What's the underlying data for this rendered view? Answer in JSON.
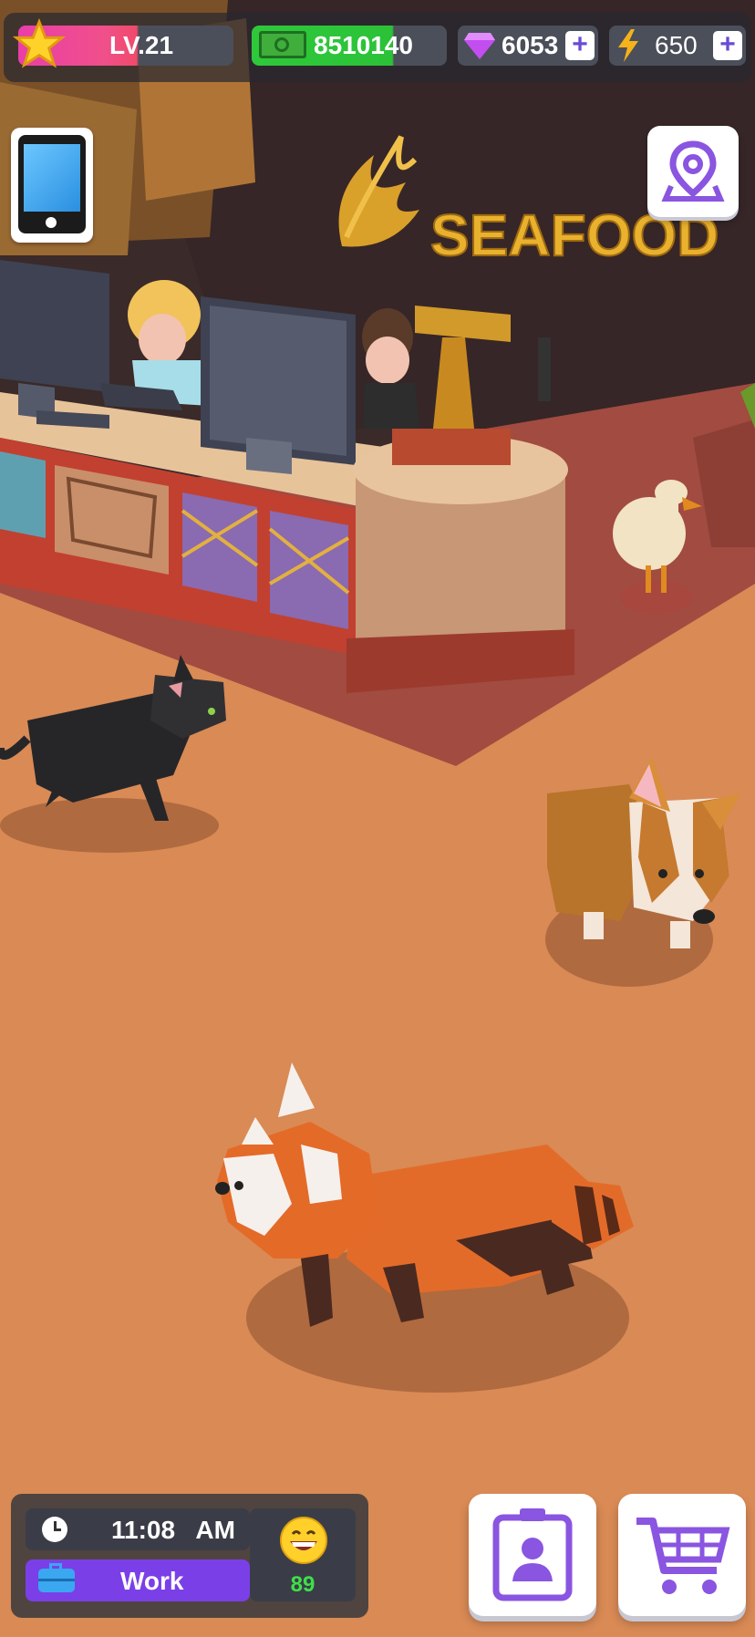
{
  "hud": {
    "level": "LV.21",
    "cash": "8510140",
    "gems": "6053",
    "energy": "650",
    "plus": "+"
  },
  "sign": {
    "text": "SEAFOOD"
  },
  "status": {
    "time": "11:08",
    "ampm": "AM",
    "activity": "Work",
    "mood_value": "89"
  },
  "colors": {
    "floor": "#d98a55",
    "accent_purple": "#7b3fe8",
    "cash_green": "#2fc83a",
    "level_pink": "#e93ea8"
  },
  "icons": [
    "star-icon",
    "cash-icon",
    "gem-icon",
    "lightning-icon",
    "phone-icon",
    "map-pin-icon",
    "clock-icon",
    "briefcase-icon",
    "smile-icon",
    "staff-card-icon",
    "cart-icon"
  ]
}
